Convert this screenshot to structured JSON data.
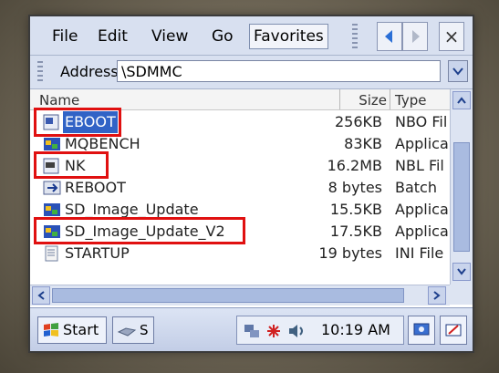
{
  "menu": {
    "file": "File",
    "edit": "Edit",
    "view": "View",
    "go": "Go",
    "favorites": "Favorites",
    "close": "×"
  },
  "address": {
    "label": "Address",
    "value": "\\SDMMC"
  },
  "columns": {
    "name": "Name",
    "size": "Size",
    "type": "Type"
  },
  "files": [
    {
      "name": "EBOOT",
      "size": "256KB",
      "type": "NBO Fil",
      "icon": "nbo-file-icon",
      "selected": true
    },
    {
      "name": "MQBENCH",
      "size": "83KB",
      "type": "Applica",
      "icon": "application-icon"
    },
    {
      "name": "NK",
      "size": "16.2MB",
      "type": "NBL Fil",
      "icon": "nbl-file-icon"
    },
    {
      "name": "REBOOT",
      "size": "8 bytes",
      "type": "Batch",
      "icon": "batch-file-icon"
    },
    {
      "name": "SD_Image_Update",
      "size": "15.5KB",
      "type": "Applica",
      "icon": "application-icon"
    },
    {
      "name": "SD_Image_Update_V2",
      "size": "17.5KB",
      "type": "Applica",
      "icon": "application-icon"
    },
    {
      "name": "STARTUP",
      "size": "19 bytes",
      "type": "INI File",
      "icon": "ini-file-icon"
    }
  ],
  "taskbar": {
    "start_label": "Start",
    "task_label": "S",
    "clock": "10:19 AM"
  },
  "colors": {
    "selection": "#3163c6",
    "highlight_box": "#e01010",
    "chrome": "#d8e0f0"
  }
}
